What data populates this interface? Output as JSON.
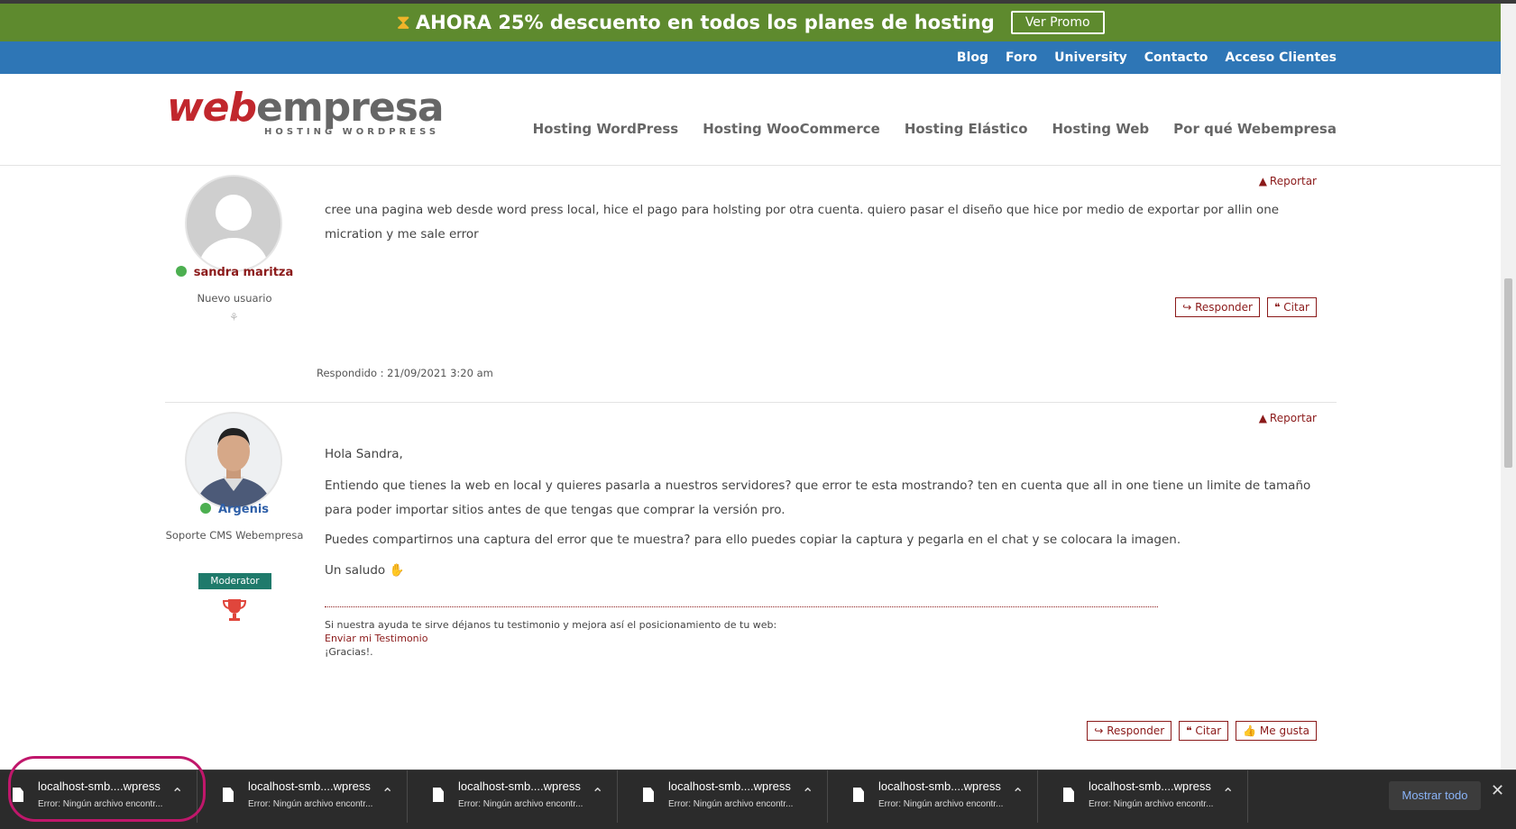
{
  "promo": {
    "text": "AHORA 25% descuento en todos los planes de hosting",
    "button": "Ver Promo"
  },
  "topnav": [
    "Blog",
    "Foro",
    "University",
    "Contacto",
    "Acceso Clientes"
  ],
  "logo": {
    "web": "web",
    "empresa": "empresa",
    "sub": "HOSTING WORDPRESS"
  },
  "mainnav": [
    "Hosting WordPress",
    "Hosting WooCommerce",
    "Hosting Elástico",
    "Hosting Web",
    "Por qué Webempresa"
  ],
  "posts": [
    {
      "author": "sandra maritza",
      "role": "Nuevo usuario",
      "report": "Reportar",
      "body": "cree una pagina web desde word press local, hice el pago para holsting por otra cuenta. quiero pasar el diseño que hice por medio de exportar por allin one micration y me sale error",
      "actions": [
        "Responder",
        "Citar"
      ],
      "respondido": "Respondido : 21/09/2021 3:20 am"
    },
    {
      "author": "Argenis",
      "role": "Soporte CMS Webempresa",
      "badge": "Moderator",
      "report": "Reportar",
      "greeting": "Hola Sandra,",
      "p1": "Entiendo que tienes la web en local y quieres pasarla a nuestros servidores? que error te esta mostrando? ten en cuenta que all in one tiene un limite de tamaño para poder importar sitios antes de que tengas que comprar la versión pro.",
      "p2": "Puedes compartirnos una captura del error que te muestra? para ello puedes copiar la captura y pegarla en el chat y se colocara la imagen.",
      "closing": "Un saludo",
      "signature": {
        "line1": "Si nuestra ayuda te sirve déjanos tu testimonio y mejora así el posicionamiento de tu web:",
        "link": "Enviar mi Testimonio",
        "line3": "¡Gracias!."
      },
      "actions": [
        "Responder",
        "Citar",
        "Me gusta"
      ]
    }
  ],
  "downloads": {
    "items": [
      {
        "name": "localhost-smb....wpress",
        "status": "Error: Ningún archivo encontr..."
      },
      {
        "name": "localhost-smb....wpress",
        "status": "Error: Ningún archivo encontr..."
      },
      {
        "name": "localhost-smb....wpress",
        "status": "Error: Ningún archivo encontr..."
      },
      {
        "name": "localhost-smb....wpress",
        "status": "Error: Ningún archivo encontr..."
      },
      {
        "name": "localhost-smb....wpress",
        "status": "Error: Ningún archivo encontr..."
      },
      {
        "name": "localhost-smb....wpress",
        "status": "Error: Ningún archivo encontr..."
      }
    ],
    "show_all": "Mostrar todo"
  },
  "colors": {
    "promo": "#5e8a2e",
    "nav": "#2e76b6",
    "brand_red": "#c1272d",
    "accent": "#8b1a1a",
    "highlight": "#c0176b"
  }
}
